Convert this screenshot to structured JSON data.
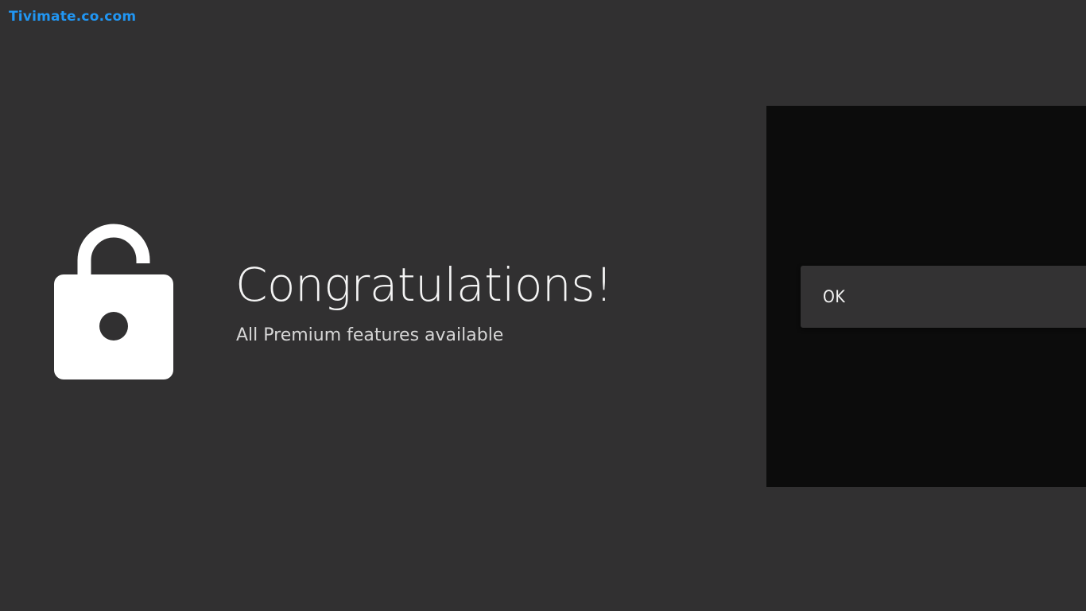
{
  "watermark": "Tivimate.co.com",
  "colors": {
    "background": "#313031",
    "panel": "#0c0c0c",
    "button": "#333233",
    "watermark": "#2196f3"
  },
  "icon": "unlocked-padlock-icon",
  "dialog": {
    "title": "Congratulations!",
    "subtitle": "All Premium features available"
  },
  "actions": {
    "ok_label": "OK"
  }
}
